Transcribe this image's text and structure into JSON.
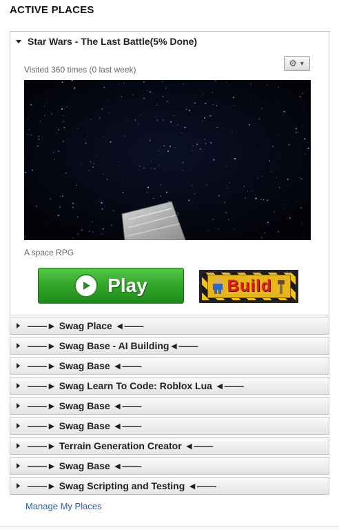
{
  "section_title": "ACTIVE PLACES",
  "featured": {
    "title": "Star Wars - The Last Battle(5% Done)",
    "visits": "Visited 360 times (0 last week)",
    "gear_icon": "gear-icon",
    "description": "A space RPG",
    "play_label": "Play",
    "build_label": "Build"
  },
  "places": [
    {
      "label": "——► Swag Place ◄——"
    },
    {
      "label": "——► Swag Base - AI Building◄——"
    },
    {
      "label": "——► Swag Base ◄——"
    },
    {
      "label": "——► Swag Learn To Code: Roblox Lua ◄——"
    },
    {
      "label": "——► Swag Base ◄——"
    },
    {
      "label": "——► Swag Base ◄——"
    },
    {
      "label": "——► Terrain Generation Creator ◄——"
    },
    {
      "label": "——► Swag Base ◄——"
    },
    {
      "label": "——► Swag Scripting and Testing ◄——"
    }
  ],
  "manage_link": "Manage My Places",
  "colors": {
    "link": "#2a5db0",
    "play_green": "#33a92b",
    "build_red": "#e11d1d",
    "hazard_yellow": "#f3c21a"
  }
}
